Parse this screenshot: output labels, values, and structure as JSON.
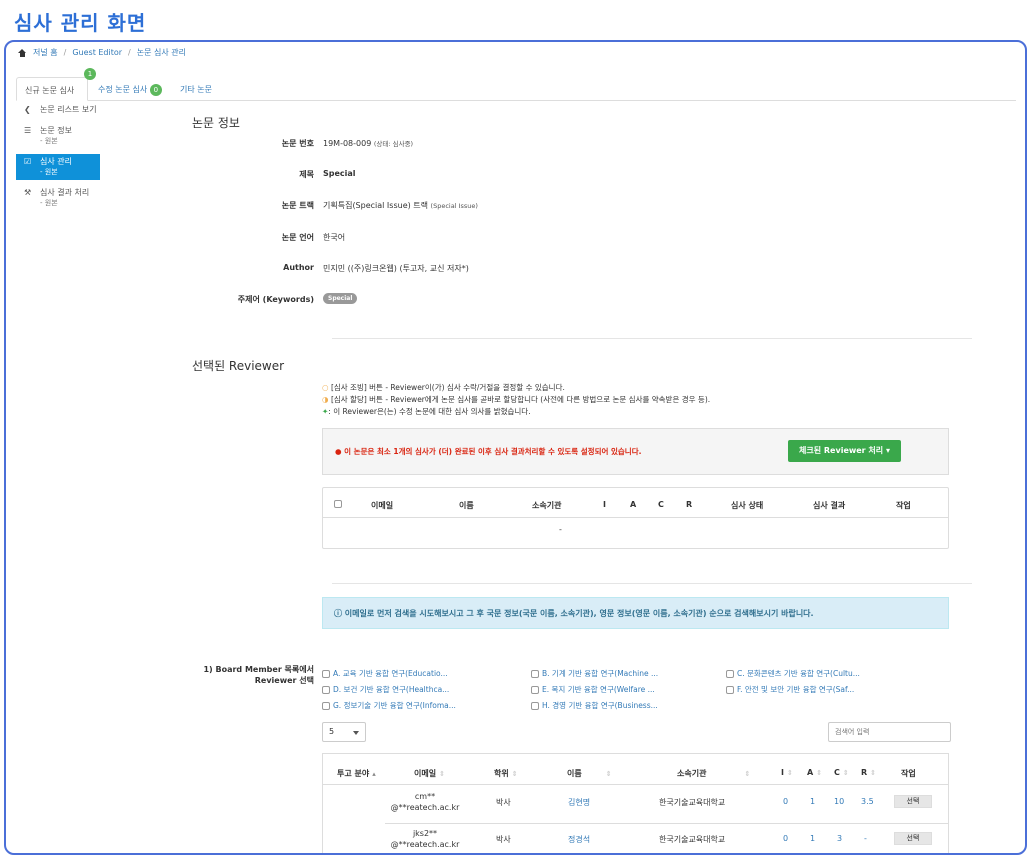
{
  "page_title": "심사 관리 화면",
  "breadcrumb": [
    "저널 홈",
    "Guest Editor",
    "논문 심사 관리"
  ],
  "tabs": [
    {
      "label": "신규 논문 심사",
      "badge": "1"
    },
    {
      "label": "수정 논문 심사",
      "badge": "0"
    },
    {
      "label": "기타 논문"
    }
  ],
  "sidebar": [
    {
      "icon": "chevron-left-icon",
      "label": "논문 리스트 보기"
    },
    {
      "icon": "list-icon",
      "label": "논문 정보",
      "sub": "- 원본"
    },
    {
      "icon": "checkbox-icon",
      "label": "심사 관리",
      "sub": "- 원본"
    },
    {
      "icon": "gavel-icon",
      "label": "심사 결과 처리",
      "sub": "- 원본"
    }
  ],
  "paper_info": {
    "title": "논문 정보",
    "rows": [
      {
        "label": "논문 번호",
        "value": "19M-08-009",
        "note": "(상태: 심사중)"
      },
      {
        "label": "제목",
        "value": "Special"
      },
      {
        "label": "논문 트랙",
        "value": "기획특집(Special Issue) 트랙",
        "note": "(Special Issue)"
      },
      {
        "label": "논문 언어",
        "value": "한국어"
      },
      {
        "label": "Author",
        "value": "민지민 ((주)링크온웹) (투고자, 교신 저자*)"
      },
      {
        "label": "주제어 (Keywords)",
        "keyword": "Special"
      }
    ]
  },
  "reviewer": {
    "title": "선택된 Reviewer",
    "legend": [
      "[심사 조빙] 버튼 - Reviewer이(가) 심사 수락/거절을 결정할 수 있습니다.",
      "[심사 할당] 버튼 - Reviewer에게 논문 심사를 곧바로 할당합니다 (사전에 다른 방법으로 논문 심사를 약속받은 경우 등).",
      ": 이 Reviewer은(는) 수정 논문에 대한 심사 의사를 밝혔습니다."
    ],
    "warning": "이 논문은 최소 1개의 심사가 (더) 완료된 이후 심사 결과처리할 수 있도록 설정되어 있습니다.",
    "action_button": "체크된 Reviewer 처리",
    "columns": [
      "이메일",
      "이름",
      "소속기관",
      "I",
      "A",
      "C",
      "R",
      "심사 상태",
      "심사 결과",
      "작업"
    ],
    "empty": "-"
  },
  "search_info": "이메일로 먼저 검색을 시도해보시고 그 후 국문 정보(국문 이름, 소속기관), 영문 정보(영문 이름, 소속기관) 순으로 검색해보시기 바랍니다.",
  "board": {
    "label": "1) Board Member 목록에서 Reviewer 선택",
    "categories": [
      "A. 교육 기반 융합 연구(Educatio...",
      "B. 기계 기반 융합 연구(Machine ...",
      "C. 문화콘텐츠 기반 융합 연구(Cultu...",
      "D. 보건 기반 융합 연구(Healthca...",
      "E. 복지 기반 융합 연구(Welfare ...",
      "F. 안전 및 보안 기반 융합 연구(Saf...",
      "G. 정보기술 기반 융합 연구(Infoma...",
      "H. 경영 기반 융합 연구(Business..."
    ],
    "page_size": "5",
    "search_placeholder": "검색어 입력",
    "columns": [
      "투고 분야",
      "이메일",
      "학위",
      "이름",
      "소속기관",
      "I",
      "A",
      "C",
      "R",
      "작업"
    ],
    "rows": [
      {
        "field": "",
        "email1": "cm**",
        "email2": "@**reatech.ac.kr",
        "degree": "박사",
        "name": "김현명",
        "org": "한국기술교육대학교",
        "I": "0",
        "A": "1",
        "C": "10",
        "R": "3.5",
        "action": "선택"
      },
      {
        "field": "",
        "email1": "jks2**",
        "email2": "@**reatech.ac.kr",
        "degree": "박사",
        "name": "정경석",
        "org": "한국기술교육대학교",
        "I": "0",
        "A": "1",
        "C": "3",
        "R": "-",
        "action": "선택"
      }
    ]
  }
}
